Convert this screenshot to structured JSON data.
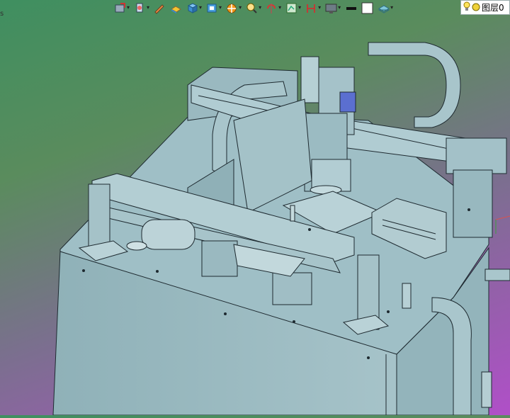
{
  "corner_mark": "s",
  "toolbar": {
    "items": [
      {
        "name": "view-orient-icon",
        "caret": true
      },
      {
        "name": "section-view-icon",
        "caret": true
      },
      {
        "name": "edit-appearance-icon",
        "caret": false
      },
      {
        "name": "display-style-icon",
        "caret": false
      },
      {
        "name": "cube-view-icon",
        "caret": true
      },
      {
        "name": "standard-views-icon",
        "caret": true
      },
      {
        "name": "hide-show-icon",
        "caret": true
      },
      {
        "name": "zoom-icon",
        "caret": true
      },
      {
        "name": "rotate-icon",
        "caret": true
      },
      {
        "name": "sketch-icon",
        "caret": true
      },
      {
        "name": "dimension-icon",
        "caret": true
      },
      {
        "name": "monitor-icon",
        "caret": true
      },
      {
        "name": "line-color-icon",
        "caret": false
      },
      {
        "name": "background-color-icon",
        "caret": false
      },
      {
        "name": "layer-icon",
        "caret": true
      }
    ]
  },
  "layer": {
    "label": "图层0"
  },
  "colors": {
    "model_fill": "#9fbfc6",
    "model_dark": "#6d8f98",
    "model_edge": "#1e2a30",
    "bg_top": "#3f8f60",
    "bg_bottom": "#b04fc8"
  }
}
